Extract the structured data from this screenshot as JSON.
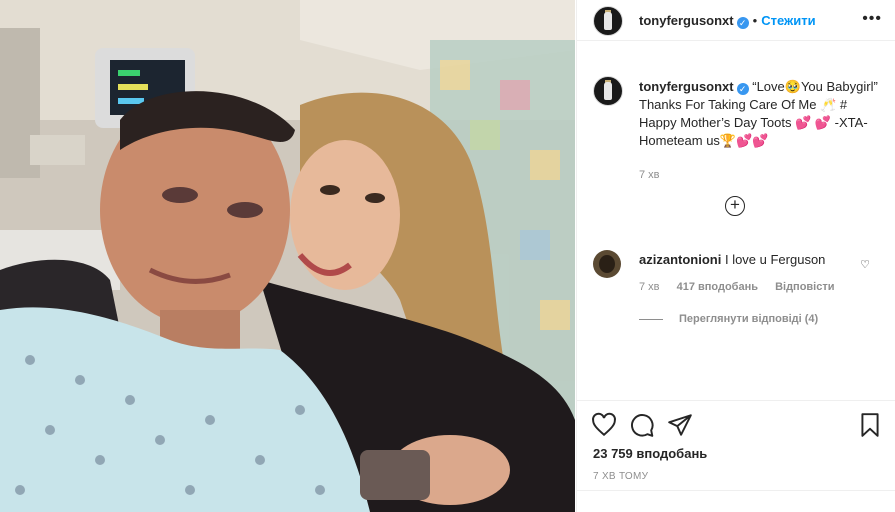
{
  "post": {
    "author": "tonyfergusonxt",
    "follow_label": "Стежити",
    "more_icon": "more-dots-icon",
    "caption_text": "“Love🥹You Babygirl” Thanks For Taking Care Of Me 🥂 # Happy Mother’s Day Toots 💕 💕 -XTA- Hometeam us🏆💕💕",
    "caption_time": "7 хв"
  },
  "comment": {
    "user": "azizantonioni",
    "text": "I love u Ferguson",
    "time": "7 хв",
    "likes": "417 вподобань",
    "reply": "Відповісти",
    "view_replies": "Переглянути відповіді (4)"
  },
  "footer": {
    "likes": "23 759 вподобань",
    "posted_ago": "7 ХВ ТОМУ"
  },
  "icons": [
    "heart-icon",
    "comment-icon",
    "share-icon",
    "bookmark-icon",
    "add-comment-plus-icon"
  ],
  "colors": {
    "accent": "#0095f6",
    "verified": "#3897f0",
    "muted": "#8e8e8e"
  }
}
